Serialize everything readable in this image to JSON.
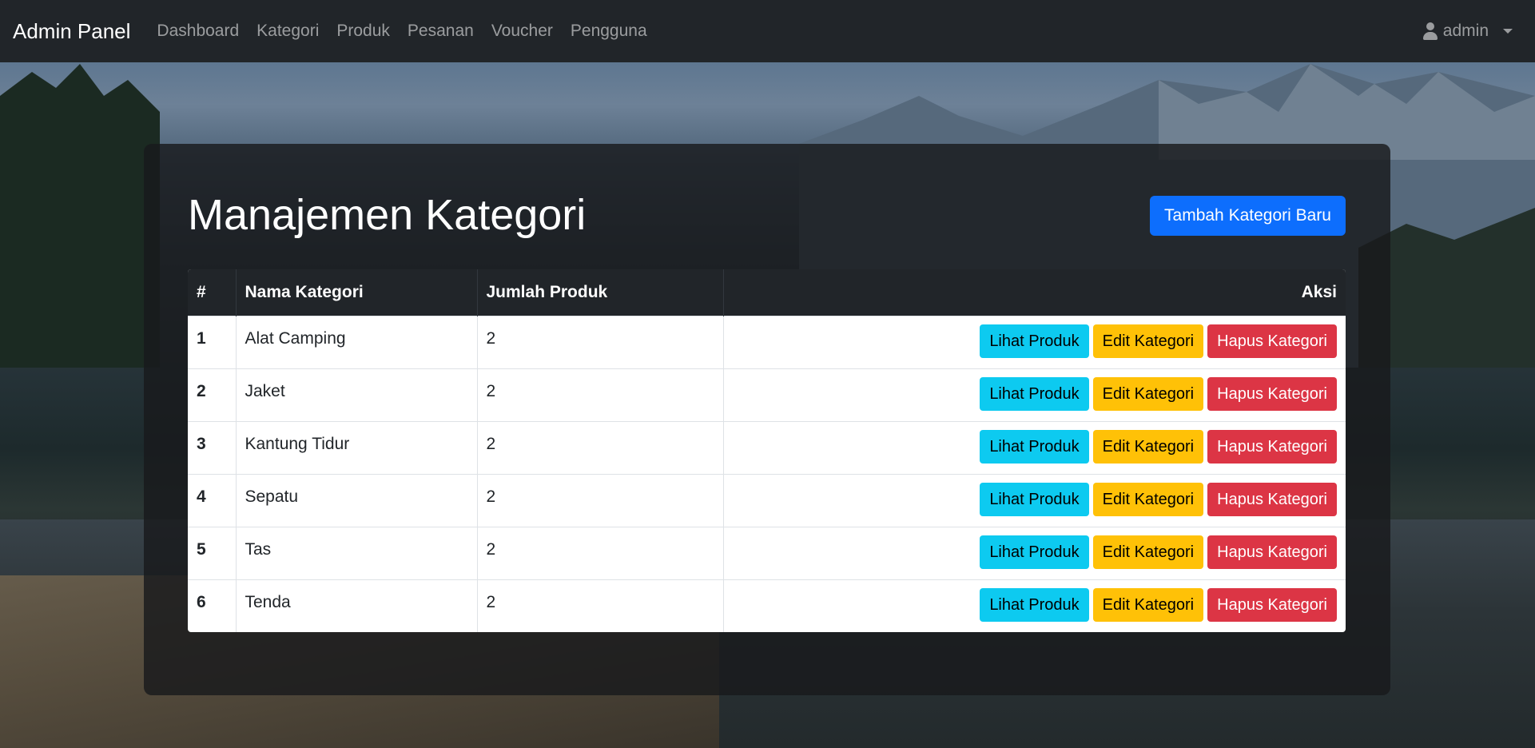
{
  "navbar": {
    "brand": "Admin Panel",
    "links": [
      "Dashboard",
      "Kategori",
      "Produk",
      "Pesanan",
      "Voucher",
      "Pengguna"
    ],
    "user": "admin"
  },
  "main": {
    "title": "Manajemen Kategori",
    "add_button": "Tambah Kategori Baru",
    "table": {
      "headers": [
        "#",
        "Nama Kategori",
        "Jumlah Produk",
        "Aksi"
      ],
      "rows": [
        {
          "no": "1",
          "name": "Alat Camping",
          "count": "2"
        },
        {
          "no": "2",
          "name": "Jaket",
          "count": "2"
        },
        {
          "no": "3",
          "name": "Kantung Tidur",
          "count": "2"
        },
        {
          "no": "4",
          "name": "Sepatu",
          "count": "2"
        },
        {
          "no": "5",
          "name": "Tas",
          "count": "2"
        },
        {
          "no": "6",
          "name": "Tenda",
          "count": "2"
        }
      ],
      "actions": {
        "view": "Lihat Produk",
        "edit": "Edit Kategori",
        "delete": "Hapus Kategori"
      }
    }
  },
  "colors": {
    "navbar": "#212529",
    "primary": "#0d6efd",
    "info": "#0dcaf0",
    "warning": "#ffc107",
    "danger": "#dc3545"
  },
  "icons": {
    "user": "user-icon",
    "caret": "caret-down-icon"
  }
}
